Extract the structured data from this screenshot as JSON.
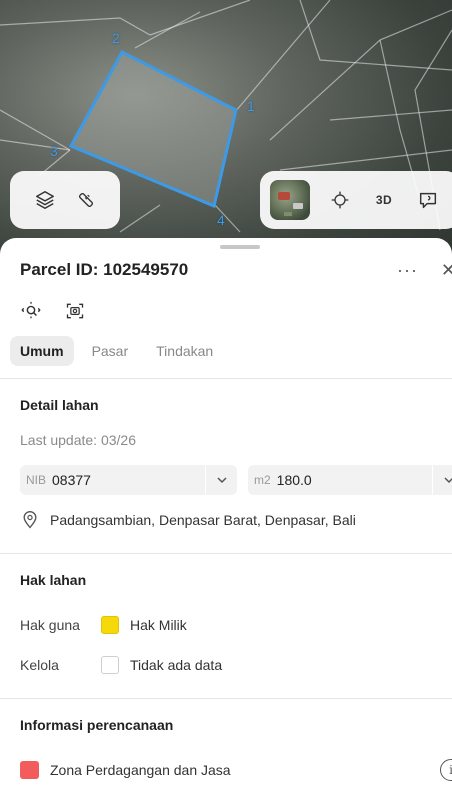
{
  "map": {
    "vertex_labels": [
      "1",
      "2",
      "3",
      "4"
    ],
    "parcel_outline_color": "#3b9be8",
    "left_controls": [
      {
        "icon": "layers-icon"
      },
      {
        "icon": "ruler-measure-icon"
      }
    ],
    "right_controls": [
      {
        "icon": "satellite-thumbnail"
      },
      {
        "icon": "crosshair-location-icon"
      },
      {
        "label": "3D"
      },
      {
        "icon": "chat-feedback-icon"
      }
    ]
  },
  "sheet": {
    "title": "Parcel ID: 102549570",
    "more_label": "···",
    "close_label": "✕",
    "tools": [
      {
        "icon": "zoom-to-parcel-icon"
      },
      {
        "icon": "camera-scan-icon"
      }
    ],
    "tabs": [
      {
        "label": "Umum",
        "active": true
      },
      {
        "label": "Pasar",
        "active": false
      },
      {
        "label": "Tindakan",
        "active": false
      }
    ]
  },
  "detail": {
    "title": "Detail lahan",
    "last_update": "Last update: 03/26",
    "nib_label": "NIB",
    "nib_value": "08377",
    "area_label": "m2",
    "area_value": "180.0",
    "location": "Padangsambian, Denpasar Barat, Denpasar, Bali"
  },
  "rights": {
    "title": "Hak lahan",
    "items": [
      {
        "key": "Hak guna",
        "value": "Hak Milik",
        "color": "#f5d90a"
      },
      {
        "key": "Kelola",
        "value": "Tidak ada data",
        "color": "#ffffff"
      }
    ]
  },
  "planning": {
    "title": "Informasi perencanaan",
    "zone": "Zona Perdagangan dan Jasa",
    "zone_color": "#f25c5c",
    "info_label": "i"
  }
}
